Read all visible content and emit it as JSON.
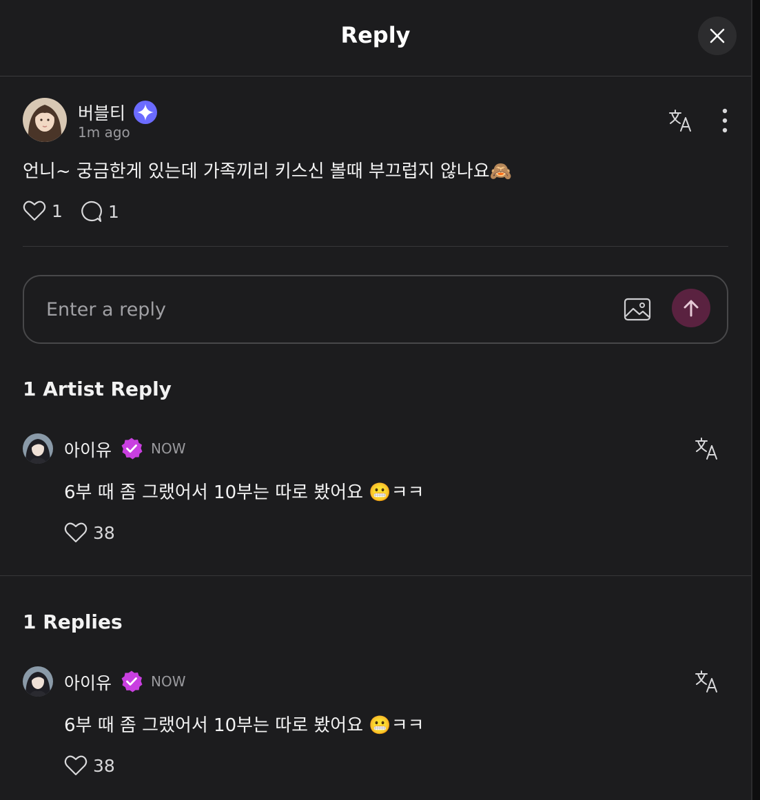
{
  "header": {
    "title": "Reply"
  },
  "post": {
    "author": "버블티",
    "time": "1m ago",
    "text": "언니~ 궁금한게 있는데 가족끼리 키스신 볼때 부끄럽지 않나요🙈",
    "likes": "1",
    "comments": "1"
  },
  "reply_input": {
    "placeholder": "Enter a reply"
  },
  "artist_section": {
    "heading": "1 Artist Reply",
    "item": {
      "author": "아이유",
      "time": "NOW",
      "text": "6부 때 좀 그랬어서 10부는 따로 봤어요 😬ㅋㅋ",
      "likes": "38"
    }
  },
  "replies_section": {
    "heading": "1 Replies",
    "item": {
      "author": "아이유",
      "time": "NOW",
      "text": "6부 때 좀 그랬어서 10부는 따로 봤어요 😬ㅋㅋ",
      "likes": "38"
    }
  },
  "colors": {
    "background": "#1c1c1e",
    "fan_badge": "#6b6bff",
    "artist_badge": "#c93fe0",
    "send_button": "#5a2240"
  },
  "icons": [
    "close-icon",
    "star-badge-icon",
    "translate-icon",
    "more-vertical-icon",
    "heart-icon",
    "comment-icon",
    "image-icon",
    "arrow-up-icon",
    "verified-badge-icon"
  ]
}
